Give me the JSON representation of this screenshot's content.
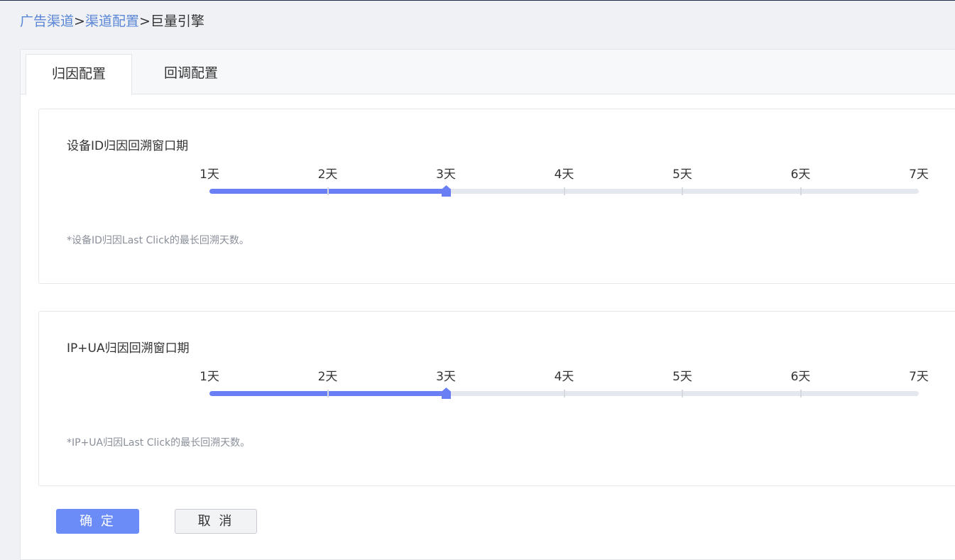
{
  "breadcrumb": {
    "items": [
      {
        "label": "广告渠道",
        "link": true
      },
      {
        "label": "渠道配置",
        "link": true
      },
      {
        "label": "巨量引擎",
        "link": false
      }
    ],
    "separator": ">"
  },
  "tabs": [
    {
      "label": "归因配置",
      "active": true
    },
    {
      "label": "回调配置",
      "active": false
    }
  ],
  "cards": [
    {
      "title": "设备ID归因回溯窗口期",
      "slider": {
        "min": 1,
        "max": 7,
        "value": 3,
        "ticks": [
          "1天",
          "2天",
          "3天",
          "4天",
          "5天",
          "6天",
          "7天"
        ]
      },
      "note": "*设备ID归因Last Click的最长回溯天数。"
    },
    {
      "title": "IP+UA归因回溯窗口期",
      "slider": {
        "min": 1,
        "max": 7,
        "value": 3,
        "ticks": [
          "1天",
          "2天",
          "3天",
          "4天",
          "5天",
          "6天",
          "7天"
        ]
      },
      "note": "*IP+UA归因Last Click的最长回溯天数。"
    }
  ],
  "actions": {
    "confirm_label": "确 定",
    "cancel_label": "取 消"
  },
  "colors": {
    "accent": "#6b7ff5",
    "link": "#5a86d6",
    "primary_button": "#6b8cf7"
  }
}
